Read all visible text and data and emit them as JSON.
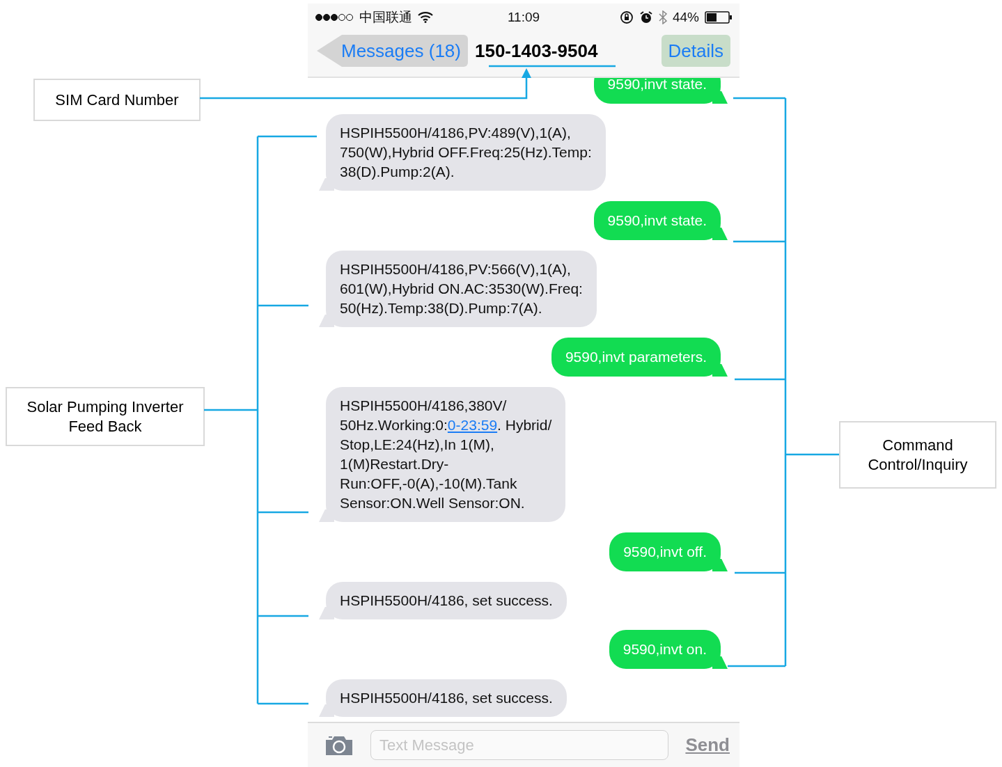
{
  "status_bar": {
    "carrier": "中国联通",
    "time": "11:09",
    "battery": "44%"
  },
  "nav": {
    "back": "Messages (18)",
    "title": "150-1403-9504",
    "details": "Details"
  },
  "messages": [
    {
      "kind": "sent",
      "parts": [
        {
          "text": "9590,invt state.",
          "kind": "text"
        }
      ]
    },
    {
      "kind": "received",
      "parts": [
        {
          "text": "HSPIH5500H/4186,PV:489(V),1(A),\n750(W),Hybrid OFF.Freq:25(Hz).Temp:\n38(D).Pump:2(A).",
          "kind": "text"
        }
      ]
    },
    {
      "kind": "sent",
      "parts": [
        {
          "text": "9590,invt state.",
          "kind": "text"
        }
      ]
    },
    {
      "kind": "received",
      "parts": [
        {
          "text": "HSPIH5500H/4186,PV:566(V),1(A),\n601(W),Hybrid ON.AC:3530(W).Freq:\n50(Hz).Temp:38(D).Pump:7(A).",
          "kind": "text"
        }
      ]
    },
    {
      "kind": "sent",
      "parts": [
        {
          "text": "9590,invt parameters.",
          "kind": "text"
        }
      ]
    },
    {
      "kind": "received",
      "parts": [
        {
          "text": "HSPIH5500H/4186,380V/\n50Hz.Working:0:",
          "kind": "text"
        },
        {
          "text": "0-23:59",
          "kind": "link"
        },
        {
          "text": ". Hybrid/\nStop,LE:24(Hz),In 1(M),\n1(M)Restart.Dry-\nRun:OFF,-0(A),-10(M).Tank\nSensor:ON.Well Sensor:ON.",
          "kind": "text"
        }
      ]
    },
    {
      "kind": "sent",
      "parts": [
        {
          "text": "9590,invt off.",
          "kind": "text"
        }
      ]
    },
    {
      "kind": "received",
      "parts": [
        {
          "text": "HSPIH5500H/4186, set success.",
          "kind": "text"
        }
      ]
    },
    {
      "kind": "sent",
      "parts": [
        {
          "text": "9590,invt on.",
          "kind": "text"
        }
      ]
    },
    {
      "kind": "received",
      "parts": [
        {
          "text": "HSPIH5500H/4186, set success.",
          "kind": "text"
        }
      ]
    }
  ],
  "input": {
    "placeholder": "Text Message",
    "send": "Send"
  },
  "annotations": {
    "sim": "SIM Card Number",
    "feedback": "Solar Pumping Inverter\nFeed Back",
    "command": "Command\nControl/Inquiry"
  }
}
